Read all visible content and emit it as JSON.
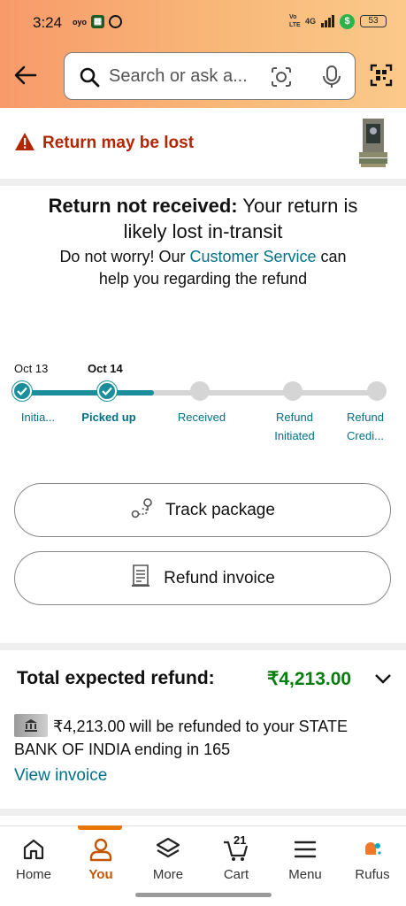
{
  "status_bar": {
    "time": "3:24",
    "oyo_label": "oyo",
    "network": "4G",
    "volte": "Vo LTE",
    "battery": "53",
    "money_symbol": "$"
  },
  "search": {
    "placeholder": "Search or ask a..."
  },
  "alert": {
    "text": "Return may be lost",
    "color": "#b12704"
  },
  "message": {
    "bold_part": "Return not received:",
    "rest_part": " Your return is likely lost in-transit",
    "line2_prefix": "Do not worry! Our ",
    "link": "Customer Service",
    "line2_suffix": " can help you regarding the refund"
  },
  "timeline": {
    "dates": [
      "Oct 13",
      "Oct 14"
    ],
    "steps": [
      {
        "label": "Initia...",
        "done": true
      },
      {
        "label": "Picked up",
        "done": true
      },
      {
        "label": "Received",
        "done": false
      },
      {
        "label": "Refund Initiated",
        "done": false
      },
      {
        "label": "Refund Credi...",
        "done": false
      }
    ],
    "accent": "#1a8e9b"
  },
  "buttons": {
    "track": "Track package",
    "invoice": "Refund invoice"
  },
  "refund": {
    "title": "Total expected refund:",
    "amount": "₹4,213.00",
    "description": "₹4,213.00 will be refunded to your STATE BANK OF INDIA ending in 165",
    "view_invoice": "View invoice",
    "amount_color": "#067d0f"
  },
  "nav": {
    "items": [
      {
        "label": "Home",
        "icon": "home-icon"
      },
      {
        "label": "You",
        "icon": "user-icon"
      },
      {
        "label": "More",
        "icon": "layers-icon"
      },
      {
        "label": "Cart",
        "icon": "cart-icon"
      },
      {
        "label": "Menu",
        "icon": "menu-icon"
      },
      {
        "label": "Rufus",
        "icon": "rufus-icon"
      }
    ],
    "cart_count": "21",
    "active_color": "#e77600"
  }
}
